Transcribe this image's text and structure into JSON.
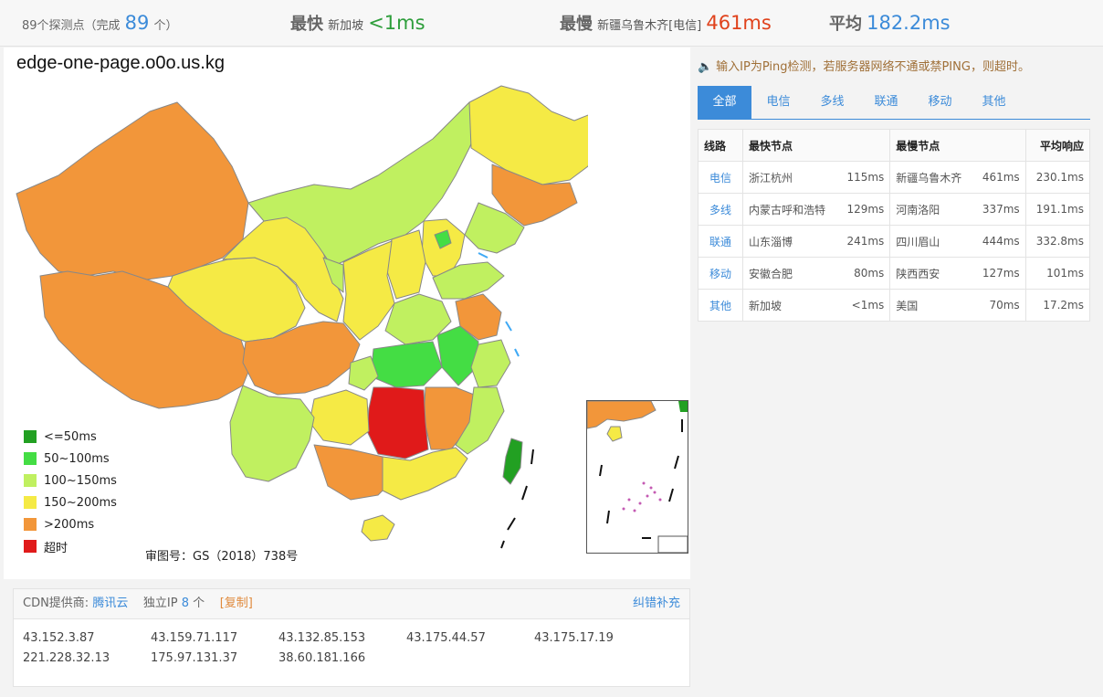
{
  "summary": {
    "nodes_text": "89个探测点（完成",
    "nodes_done": "89",
    "nodes_unit": "个）",
    "fastest_label": "最快",
    "fastest_node": "新加坡",
    "fastest_value": "<1ms",
    "slowest_label": "最慢",
    "slowest_node": "新疆乌鲁木齐[电信]",
    "slowest_value": "461ms",
    "avg_label": "平均",
    "avg_value": "182.2ms"
  },
  "map": {
    "domain": "edge-one-page.o0o.us.kg",
    "approval": "审图号：GS（2018）738号",
    "legend": [
      {
        "label": "<=50ms",
        "color": "#22a022"
      },
      {
        "label": "50~100ms",
        "color": "#44dd44"
      },
      {
        "label": "100~150ms",
        "color": "#c0f060"
      },
      {
        "label": "150~200ms",
        "color": "#f5ea45"
      },
      {
        "label": ">200ms",
        "color": "#f2963a"
      },
      {
        "label": "超时",
        "color": "#e01a1a"
      }
    ]
  },
  "cdn": {
    "provider_label": "CDN提供商:",
    "provider": "腾讯云",
    "ip_label": "独立IP",
    "ip_count": "8",
    "ip_unit": "个",
    "copy": "[复制]",
    "fix": "纠错补充",
    "ips": [
      "43.152.3.87",
      "43.159.71.117",
      "43.132.85.153",
      "43.175.44.57",
      "43.175.17.19",
      "221.228.32.13",
      "175.97.131.37",
      "38.60.181.166"
    ]
  },
  "notice": "输入IP为Ping检测，若服务器网络不通或禁PING，则超时。",
  "tabs": [
    "全部",
    "电信",
    "多线",
    "联通",
    "移动",
    "其他"
  ],
  "table": {
    "headers": [
      "线路",
      "最快节点",
      "最慢节点",
      "平均响应"
    ],
    "rows": [
      {
        "line": "电信",
        "fast": "浙江杭州",
        "fast_ms": "115ms",
        "slow": "新疆乌鲁木齐",
        "slow_ms": "461ms",
        "avg": "230.1ms"
      },
      {
        "line": "多线",
        "fast": "内蒙古呼和浩特",
        "fast_ms": "129ms",
        "slow": "河南洛阳",
        "slow_ms": "337ms",
        "avg": "191.1ms"
      },
      {
        "line": "联通",
        "fast": "山东淄博",
        "fast_ms": "241ms",
        "slow": "四川眉山",
        "slow_ms": "444ms",
        "avg": "332.8ms"
      },
      {
        "line": "移动",
        "fast": "安徽合肥",
        "fast_ms": "80ms",
        "slow": "陕西西安",
        "slow_ms": "127ms",
        "avg": "101ms"
      },
      {
        "line": "其他",
        "fast": "新加坡",
        "fast_ms": "<1ms",
        "slow": "美国",
        "slow_ms": "70ms",
        "avg": "17.2ms"
      }
    ]
  },
  "colors": {
    "accent": "#3c8bd9",
    "fast": "#2e9e3b",
    "slow": "#e0421c",
    "timeout": "#e01a1a",
    "over200": "#f2963a"
  }
}
